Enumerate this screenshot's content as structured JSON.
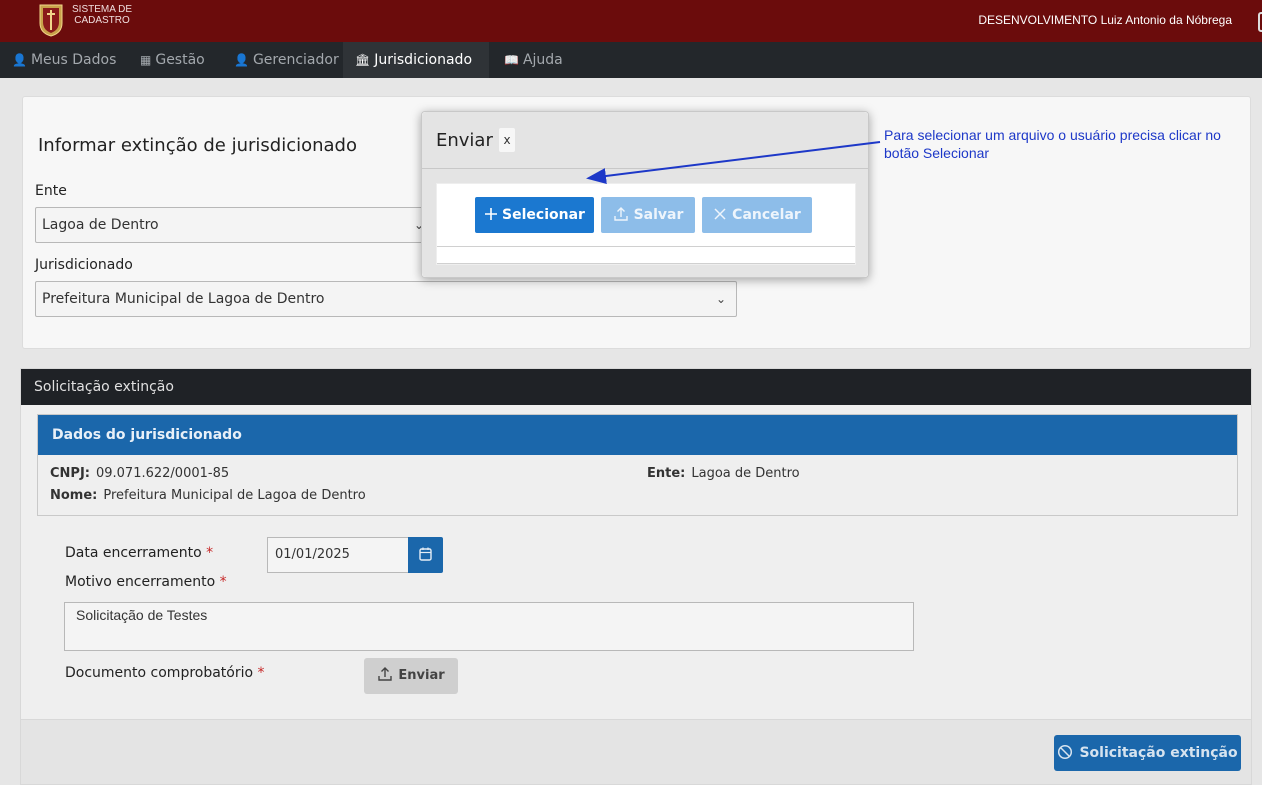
{
  "header": {
    "logo_text_line1": "SISTEMA DE",
    "logo_text_line2": "CADASTRO",
    "user": "DESENVOLVIMENTO Luiz Antonio da Nóbrega"
  },
  "nav": {
    "items": [
      {
        "label": "Meus Dados",
        "icon": "user-icon"
      },
      {
        "label": "Gestão",
        "icon": "calendar-icon"
      },
      {
        "label": "Gerenciador",
        "icon": "user-icon"
      },
      {
        "label": "Jurisdicionado",
        "icon": "bank-icon",
        "active": true
      },
      {
        "label": "Ajuda",
        "icon": "book-icon"
      }
    ]
  },
  "form": {
    "title": "Informar extinção de jurisdicionado",
    "ente_label": "Ente",
    "ente_value": "Lagoa de Dentro",
    "jurisdicionado_label": "Jurisdicionado",
    "jurisdicionado_value": "Prefeitura Municipal de Lagoa de Dentro"
  },
  "solicitacao": {
    "header": "Solicitação extinção",
    "dados_header": "Dados do jurisdicionado",
    "cnpj_label": "CNPJ:",
    "cnpj_value": "09.071.622/0001-85",
    "nome_label": "Nome:",
    "nome_value": "Prefeitura Municipal de Lagoa de Dentro",
    "ente_label": "Ente:",
    "ente_value": "Lagoa de Dentro",
    "data_label": "Data encerramento",
    "data_value": "01/01/2025",
    "motivo_label": "Motivo encerramento",
    "motivo_value": "Solicitação de Testes",
    "documento_label": "Documento comprobatório",
    "required_mark": "*",
    "enviar_label": "Enviar",
    "submit_label": "Solicitação extinção"
  },
  "modal": {
    "title": "Enviar",
    "close": "x",
    "selecionar": "Selecionar",
    "salvar": "Salvar",
    "cancelar": "Cancelar"
  },
  "annotation": {
    "text": "Para selecionar um arquivo o usuário precisa clicar no botão Selecionar"
  },
  "colors": {
    "header_bg": "#6b0c0c",
    "nav_bg": "#23272b",
    "primary": "#1b67ab",
    "annotation": "#1d38c8"
  }
}
